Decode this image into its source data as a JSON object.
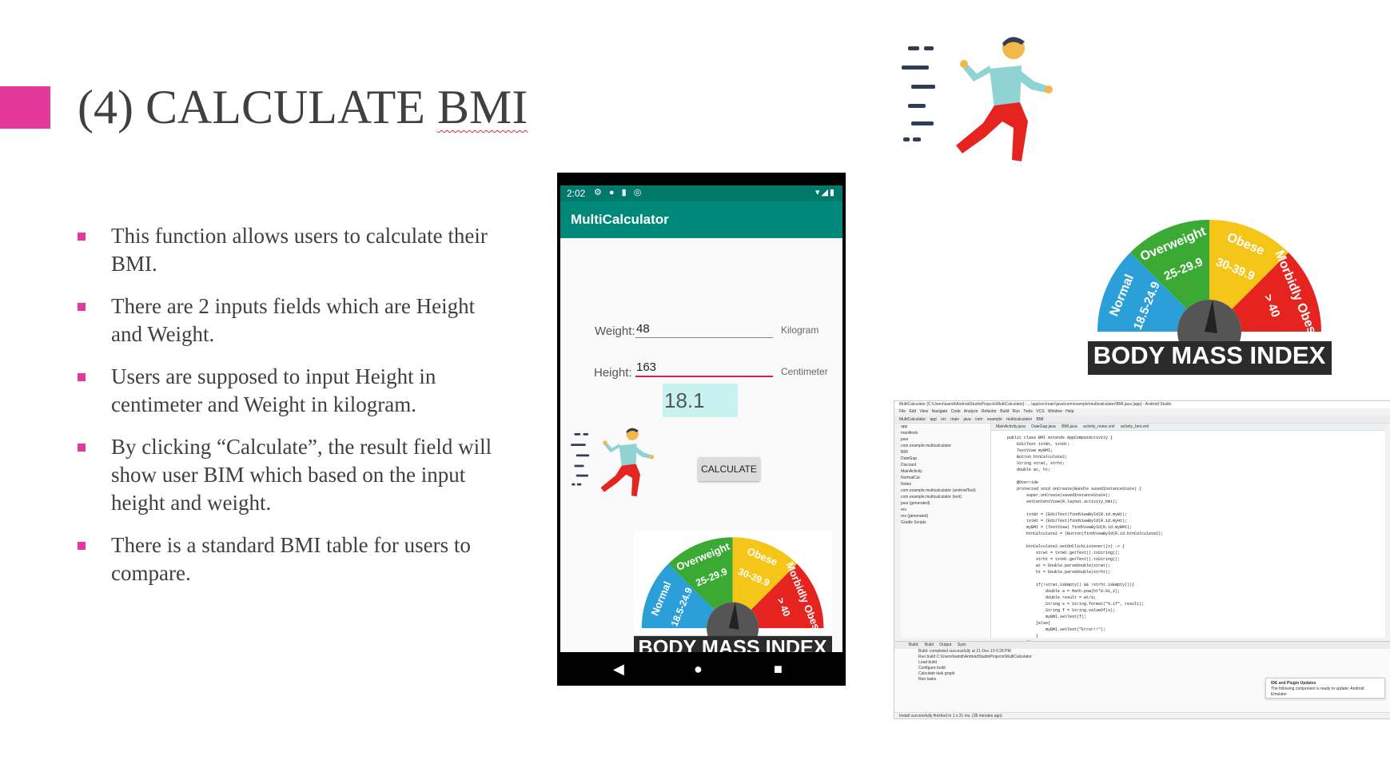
{
  "slide": {
    "title_prefix": "(4) CALCULATE ",
    "title_word": "BMI",
    "accent_color": "#e5389b",
    "bullets": [
      "This function allows users to calculate their BMI.",
      "There are 2 inputs fields which are Height and Weight.",
      "Users are supposed to input Height in centimeter and Weight in kilogram.",
      "By clicking “Calculate”, the result field will show user BIM which based on the input height and weight.",
      "There is a standard BMI table for users to compare."
    ]
  },
  "phone": {
    "status_time": "2:02",
    "status_icons": "⚙ ● ▮ ◎",
    "status_right": "▾◢▮",
    "app_title": "MultiCalculator",
    "weight_label": "Weight:",
    "weight_value": "48",
    "weight_unit": "Kilogram",
    "height_label": "Height:",
    "height_value": "163",
    "height_unit": "Centimeter",
    "result_value": "18.1",
    "calculate_label": "CALCULATE",
    "nav_back": "◀",
    "nav_home": "●",
    "nav_recent": "■",
    "appbar_color": "#00897b"
  },
  "gauge": {
    "segments": [
      "Normal",
      "Overweight",
      "Obese",
      "Morbidly Obese"
    ],
    "ranges": [
      "18.5-24.9",
      "25-29.9",
      "30-39.9",
      "> 40"
    ],
    "caption": "BODY MASS INDEX",
    "colors": [
      "#2a9fd8",
      "#3aaa35",
      "#f5c518",
      "#e52420"
    ]
  },
  "studio": {
    "window_title": "MultiCalculator [C:\\Users\\kaindi\\AndroidStudioProjects\\MultiCalculator] - ...\\app\\src\\main\\java\\com\\example\\multicalculator\\BMI.java [app] - Android Studio",
    "menu": "File Edit View Navigate Code Analyze Refactor Build Run Tools VCS Window Help",
    "toolbar": "MultiCalculator app src main java com example multicalculator BMI",
    "tabs": "MainActivity.java DateGap.java BMI.java activity_notes.xml activity_bmi.xml",
    "tree": [
      "app",
      "manifests",
      "java",
      "com.example.multicalculator",
      "BMI",
      "DateGap",
      "Discount",
      "MainActivity",
      "NormalCal",
      "Notes",
      "com.example.multicalculator (androidTest)",
      "com.example.multicalculator (test)",
      "java (generated)",
      "res",
      "res (generated)",
      "Gradle Scripts"
    ],
    "code": [
      "public class BMI extends AppCompatActivity {",
      "    EditText txtWt, txtHt;",
      "    TextView myBMI;",
      "    Button btnCalculate2;",
      "    String strwt, strht;",
      "    double wt, ht;",
      "",
      "    @Override",
      "    protected void onCreate(Bundle savedInstanceState) {",
      "        super.onCreate(savedInstanceState);",
      "        setContentView(R.layout.activity_bmi);",
      "",
      "        txtWt = (EditText)findViewById(R.id.myWt);",
      "        txtHt = (EditText)findViewById(R.id.myHt);",
      "        myBMI = (TextView) findViewById(R.id.myBMI);",
      "        btnCalculate2 = (Button)findViewById(R.id.btnCalculate2);",
      "",
      "        btnCalculate2.setOnClickListener((v) -> {",
      "            strwt = txtWt.getText().toString();",
      "            strht = txtHt.getText().toString();",
      "            wt = Double.parseDouble(strwt);",
      "            ht = Double.parseDouble(strht);",
      "",
      "            if(!strwt.isEmpty() && !strht.isEmpty()){",
      "                double a = Math.pow(ht*0.01,2);",
      "                double result = wt/a;",
      "                String s = String.format(\"%.1f\", result);",
      "                String f = String.valueOf(s);",
      "                myBMI.setText(f);",
      "            }else{",
      "                myBMI.setText(\"Error!!\");",
      "            }",
      "        });"
    ],
    "build_header": "Build: Build Output Sync",
    "build_lines": [
      "Build: completed successfully at 21-Dec-19 6:28 PM",
      "Run build C:\\Users\\kaindi\\AndroidStudioProjects\\MultiCalculator",
      "Load build",
      "Configure build",
      "Calculate task graph",
      "Run tasks"
    ],
    "notif_title": "IDE and Plugin Updates",
    "notif_body": "The following component is ready to update: Android Emulator",
    "status": "Install successfully finished in 1 s 31 ms. (35 minutes ago)"
  }
}
